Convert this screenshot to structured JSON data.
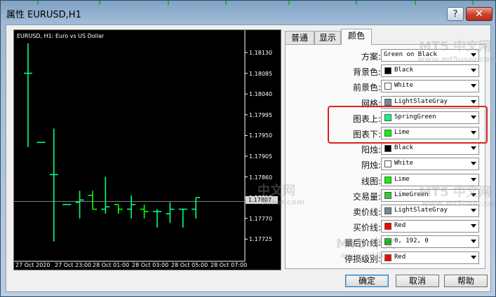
{
  "window": {
    "title": "属性 EURUSD,H1",
    "help_glyph": "?",
    "close_glyph": "✕"
  },
  "chart": {
    "title": "EURUSD, H1:  Euro vs US Dollar",
    "price_labels": [
      "1.18130",
      "1.18085",
      "1.18040",
      "1.17995",
      "1.17950",
      "1.17905",
      "1.17860",
      "1.17815",
      "1.17770",
      "1.17725"
    ],
    "current_price": "1.17807",
    "time_labels": [
      "27 Oct 2020",
      "27 Oct 23:00",
      "28 Oct 01:00",
      "28 Oct 03:00",
      "28 Oct 05:00",
      "28 Oct 07:00"
    ]
  },
  "tabs": [
    {
      "label": "普通"
    },
    {
      "label": "显示"
    },
    {
      "label": "颜色"
    }
  ],
  "settings": [
    {
      "label": "方案:",
      "value": "Green on Black",
      "color": null
    },
    {
      "label": "背景色:",
      "value": "Black",
      "color": "#000000"
    },
    {
      "label": "前景色:",
      "value": "White",
      "color": "#ffffff"
    },
    {
      "label": "网格:",
      "value": "LightSlateGray",
      "color": "#778899"
    },
    {
      "label": "图表上:",
      "value": "SpringGreen",
      "color": "#00ff7f"
    },
    {
      "label": "图表下:",
      "value": "Lime",
      "color": "#00ff00"
    },
    {
      "label": "阳烛:",
      "value": "Black",
      "color": "#000000"
    },
    {
      "label": "阴烛:",
      "value": "White",
      "color": "#ffffff"
    },
    {
      "label": "线图:",
      "value": "Lime",
      "color": "#00ff00"
    },
    {
      "label": "交易量:",
      "value": "LimeGreen",
      "color": "#32cd32"
    },
    {
      "label": "卖价线:",
      "value": "LightSlateGray",
      "color": "#778899"
    },
    {
      "label": "买价线:",
      "value": "Red",
      "color": "#ff0000"
    },
    {
      "label": "最后价线:",
      "value": "0, 192, 0",
      "color": "#00c000"
    },
    {
      "label": "停损级别:",
      "value": "Red",
      "color": "#ff0000"
    }
  ],
  "buttons": {
    "ok": "确定",
    "cancel": "取消",
    "help": "帮助"
  },
  "watermarks": [
    "MT5 中文网",
    "www.mt5user.com",
    "中文网",
    "5user.com",
    "MT5 中文网",
    "www.mt5user.com",
    "MT5 中文",
    "www.mt5u"
  ],
  "candles": [
    {
      "o": 1.18085,
      "h": 1.1815,
      "l": 1.17925,
      "c": 1.18085
    },
    {
      "o": 1.17935,
      "h": 1.17935,
      "l": 1.17935,
      "c": 1.17935
    },
    {
      "o": 1.17865,
      "h": 1.17965,
      "l": 1.1772,
      "c": 1.17865
    },
    {
      "o": 1.178,
      "h": 1.178,
      "l": 1.178,
      "c": 1.178
    },
    {
      "o": 1.17805,
      "h": 1.1783,
      "l": 1.1777,
      "c": 1.1781
    },
    {
      "o": 1.1782,
      "h": 1.1783,
      "l": 1.1779,
      "c": 1.1779
    },
    {
      "o": 1.1779,
      "h": 1.1786,
      "l": 1.1778,
      "c": 1.17795
    },
    {
      "o": 1.178,
      "h": 1.178,
      "l": 1.1778,
      "c": 1.1779
    },
    {
      "o": 1.1779,
      "h": 1.1782,
      "l": 1.1777,
      "c": 1.178
    },
    {
      "o": 1.1779,
      "h": 1.178,
      "l": 1.1777,
      "c": 1.17785
    },
    {
      "o": 1.17785,
      "h": 1.1779,
      "l": 1.1775,
      "c": 1.17785
    },
    {
      "o": 1.1778,
      "h": 1.17805,
      "l": 1.1776,
      "c": 1.1779
    },
    {
      "o": 1.1779,
      "h": 1.1779,
      "l": 1.1775,
      "c": 1.1779
    },
    {
      "o": 1.1779,
      "h": 1.17815,
      "l": 1.1777,
      "c": 1.17815
    }
  ]
}
